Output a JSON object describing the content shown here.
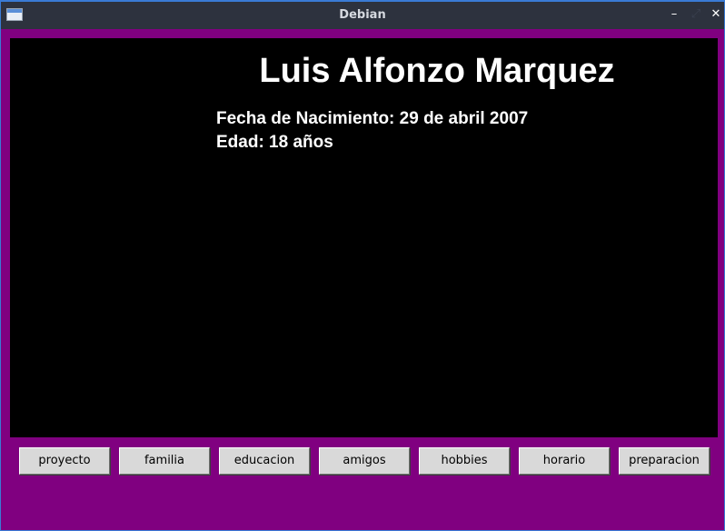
{
  "window": {
    "title": "Debian",
    "controls": {
      "minimize": "–",
      "maximize": "⤢",
      "close": "✕"
    },
    "background_color": "#800080"
  },
  "canvas": {
    "background_color": "#000000",
    "name": "Luis Alfonzo Marquez",
    "birth_line": "Fecha de Nacimiento: 29 de abril 2007",
    "age_line": "Edad: 18 años",
    "text_color": "#ffffff"
  },
  "buttons": [
    {
      "label": "proyecto"
    },
    {
      "label": "familia"
    },
    {
      "label": "educacion"
    },
    {
      "label": "amigos"
    },
    {
      "label": "hobbies"
    },
    {
      "label": "horario"
    },
    {
      "label": "preparacion"
    }
  ]
}
